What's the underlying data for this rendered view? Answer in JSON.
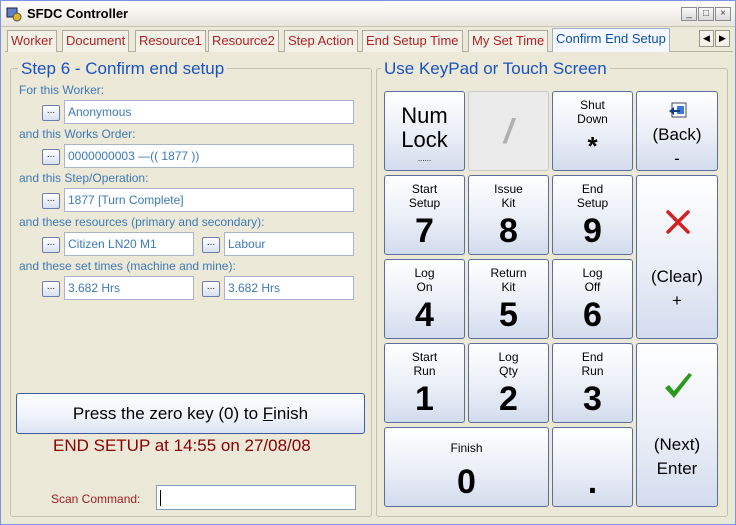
{
  "window": {
    "title": "SFDC Controller"
  },
  "tabs": [
    {
      "label": "Worker"
    },
    {
      "label": "Document"
    },
    {
      "label": "Resource1"
    },
    {
      "label": "Resource2"
    },
    {
      "label": "Step Action"
    },
    {
      "label": "End Setup Time"
    },
    {
      "label": "My Set Time"
    },
    {
      "label": "Confirm End Setup"
    }
  ],
  "left": {
    "title": "Step 6 - Confirm end setup",
    "worker_label": "For this Worker:",
    "worker_value": "Anonymous",
    "order_label": "and this Works Order:",
    "order_value": "0000000003    —(( 1877 ))",
    "step_label": "and this Step/Operation:",
    "step_value": "1877 [Turn Complete]",
    "resources_label": "and these resources (primary and secondary):",
    "resource_primary": "Citizen LN20 M1",
    "resource_secondary": "Labour",
    "times_label": "and these set times (machine and mine):",
    "time_machine": "3.682 Hrs",
    "time_mine": "3.682 Hrs",
    "dots_label": "...",
    "finish_pre": "Press the zero key (0) to ",
    "finish_key": "F",
    "finish_post": "inish",
    "status": "END SETUP at 14:55 on 27/08/08",
    "scan_label": "Scan Command:",
    "scan_value": ""
  },
  "keypad": {
    "title": "Use KeyPad or Touch Screen",
    "numlock_line1": "Num",
    "numlock_line2": "Lock",
    "numlock_sub": "......",
    "slash": "/",
    "shutdown_line1": "Shut",
    "shutdown_line2": "Down",
    "shutdown_key": "*",
    "back_label": "(Back)",
    "back_key": "-",
    "k7_line1": "Start",
    "k7_line2": "Setup",
    "k7": "7",
    "k8_line1": "Issue",
    "k8_line2": "Kit",
    "k8": "8",
    "k9_line1": "End",
    "k9_line2": "Setup",
    "k9": "9",
    "clear_label": "(Clear)",
    "clear_key": "+",
    "k4_line1": "Log",
    "k4_line2": "On",
    "k4": "4",
    "k5_line1": "Return",
    "k5_line2": "Kit",
    "k5": "5",
    "k6_line1": "Log",
    "k6_line2": "Off",
    "k6": "6",
    "k1_line1": "Start",
    "k1_line2": "Run",
    "k1": "1",
    "k2_line1": "Log",
    "k2_line2": "Qty",
    "k2": "2",
    "k3_line1": "End",
    "k3_line2": "Run",
    "k3": "3",
    "next_label": "(Next)",
    "next_key": "Enter",
    "k0_line1": "Finish",
    "k0": "0",
    "dot": ".",
    "icons": {
      "back": "back-arrow-icon",
      "clear": "red-x-icon",
      "next": "green-check-icon"
    },
    "colors": {
      "clear_x": "#d42020",
      "next_check": "#2a9a1a"
    }
  }
}
